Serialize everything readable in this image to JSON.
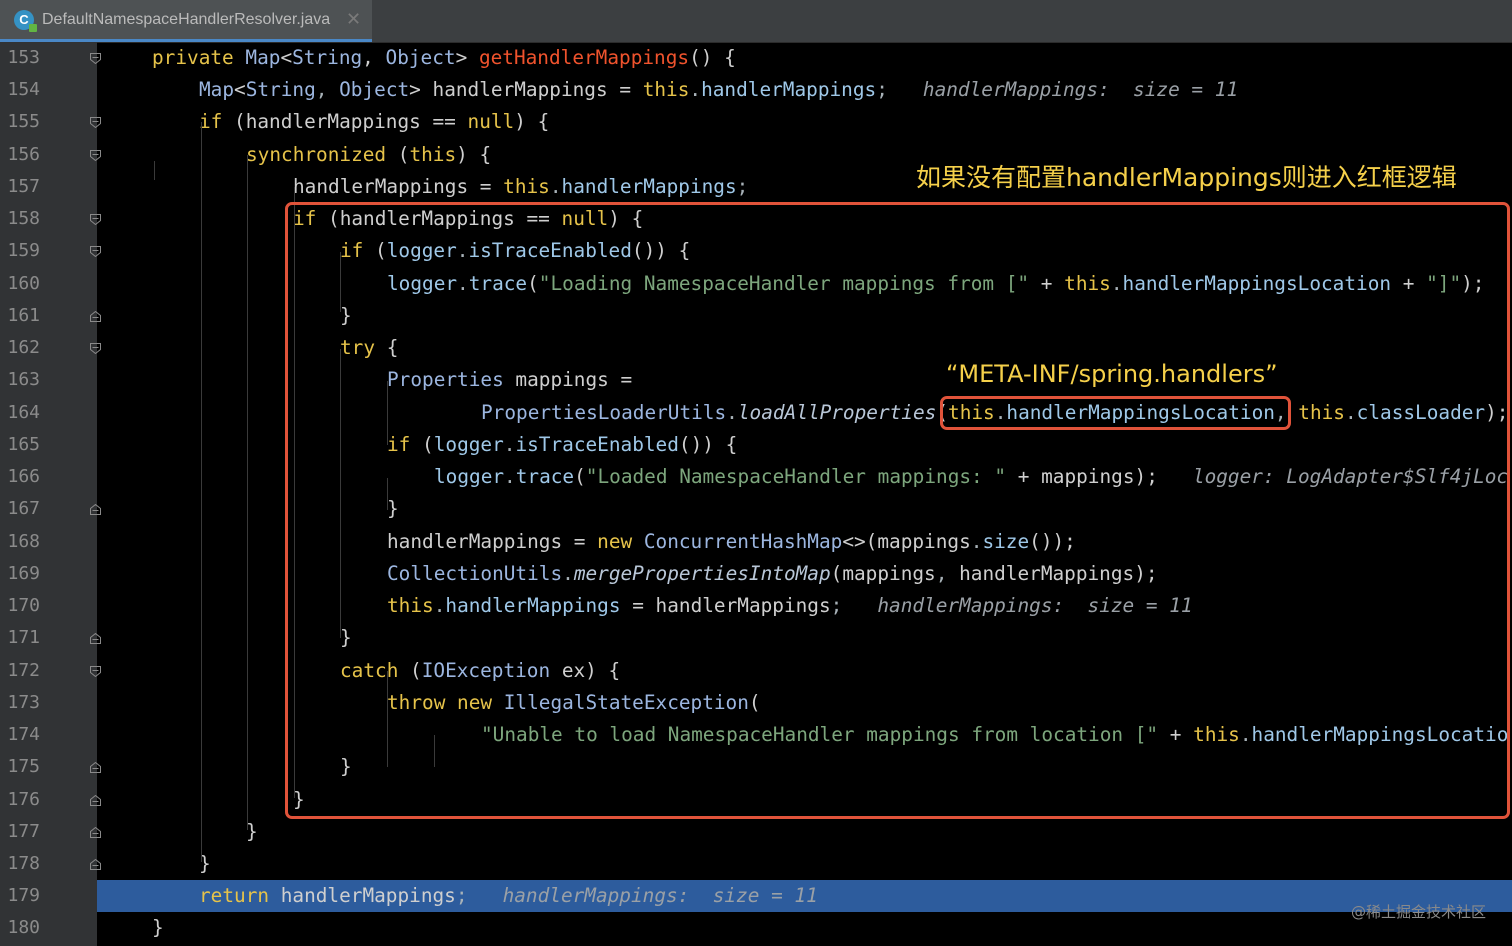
{
  "tab": {
    "title": "DefaultNamespaceHandlerResolver.java",
    "icon": "class-file-icon",
    "close": "✕"
  },
  "lines": [
    {
      "n": "153",
      "fold": "open",
      "indent": 0,
      "toks": [
        [
          "private ",
          "k"
        ],
        [
          "Map",
          "t"
        ],
        [
          "<",
          "p"
        ],
        [
          "String",
          "t"
        ],
        [
          ", ",
          "p"
        ],
        [
          "Object",
          "t"
        ],
        [
          "> ",
          "p"
        ],
        [
          "getHandlerMappings",
          "m"
        ],
        [
          "() {",
          "p"
        ]
      ]
    },
    {
      "n": "154",
      "fold": "",
      "indent": 1,
      "toks": [
        [
          "Map",
          "t"
        ],
        [
          "<",
          "p"
        ],
        [
          "String",
          "t"
        ],
        [
          ", ",
          "d"
        ],
        [
          "Object",
          "t"
        ],
        [
          "> ",
          "p"
        ],
        [
          "handlerMappings",
          "p"
        ],
        [
          " = ",
          "p"
        ],
        [
          "this",
          "k"
        ],
        [
          ".",
          "d"
        ],
        [
          "handlerMappings",
          "f"
        ],
        [
          ";",
          "d"
        ],
        [
          "   handlerMappings:  size = 11",
          "hint"
        ]
      ]
    },
    {
      "n": "155",
      "fold": "open",
      "indent": 1,
      "toks": [
        [
          "if ",
          "k"
        ],
        [
          "(handlerMappings ",
          "p"
        ],
        [
          "== ",
          "p"
        ],
        [
          "null",
          "k"
        ],
        [
          ") {",
          "p"
        ]
      ]
    },
    {
      "n": "156",
      "fold": "open",
      "indent": 2,
      "toks": [
        [
          "synchronized ",
          "k"
        ],
        [
          "(",
          "p"
        ],
        [
          "this",
          "k"
        ],
        [
          ") {",
          "p"
        ]
      ]
    },
    {
      "n": "157",
      "fold": "",
      "indent": 3,
      "toks": [
        [
          "handlerMappings",
          "p"
        ],
        [
          " = ",
          "p"
        ],
        [
          "this",
          "k"
        ],
        [
          ".",
          "d"
        ],
        [
          "handlerMappings",
          "f"
        ],
        [
          ";",
          "d"
        ]
      ]
    },
    {
      "n": "158",
      "fold": "open",
      "indent": 3,
      "toks": [
        [
          "if ",
          "k"
        ],
        [
          "(handlerMappings ",
          "p"
        ],
        [
          "== ",
          "p"
        ],
        [
          "null",
          "k"
        ],
        [
          ") {",
          "p"
        ]
      ]
    },
    {
      "n": "159",
      "fold": "open",
      "indent": 4,
      "toks": [
        [
          "if ",
          "k"
        ],
        [
          "(",
          "p"
        ],
        [
          "logger",
          "f"
        ],
        [
          ".",
          "d"
        ],
        [
          "isTraceEnabled",
          "f"
        ],
        [
          "()) {",
          "p"
        ]
      ]
    },
    {
      "n": "160",
      "fold": "",
      "indent": 5,
      "toks": [
        [
          "logger",
          "f"
        ],
        [
          ".",
          "d"
        ],
        [
          "trace",
          "f"
        ],
        [
          "(",
          "p"
        ],
        [
          "\"Loading NamespaceHandler mappings from [\"",
          "s"
        ],
        [
          " + ",
          "p"
        ],
        [
          "this",
          "k"
        ],
        [
          ".",
          "d"
        ],
        [
          "handlerMappingsLocation",
          "f"
        ],
        [
          " + ",
          "p"
        ],
        [
          "\"]\"",
          "s"
        ],
        [
          ");",
          "p"
        ]
      ]
    },
    {
      "n": "161",
      "fold": "close",
      "indent": 4,
      "toks": [
        [
          "}",
          "p"
        ]
      ]
    },
    {
      "n": "162",
      "fold": "open",
      "indent": 4,
      "toks": [
        [
          "try ",
          "k"
        ],
        [
          "{",
          "p"
        ]
      ]
    },
    {
      "n": "163",
      "fold": "",
      "indent": 5,
      "toks": [
        [
          "Properties ",
          "t"
        ],
        [
          "mappings",
          "p"
        ],
        [
          " =",
          "p"
        ]
      ]
    },
    {
      "n": "164",
      "fold": "",
      "indent": 7,
      "toks": [
        [
          "PropertiesLoaderUtils",
          "t"
        ],
        [
          ".",
          "d"
        ],
        [
          "loadAllProperties",
          "it"
        ],
        [
          "(",
          "p"
        ],
        [
          "this",
          "k"
        ],
        [
          ".",
          "d"
        ],
        [
          "handlerMappingsLocation",
          "f"
        ],
        [
          ", ",
          "d"
        ],
        [
          "this",
          "k"
        ],
        [
          ".",
          "d"
        ],
        [
          "classLoader",
          "f"
        ],
        [
          ");",
          "p"
        ]
      ]
    },
    {
      "n": "165",
      "fold": "",
      "indent": 5,
      "toks": [
        [
          "if ",
          "k"
        ],
        [
          "(",
          "p"
        ],
        [
          "logger",
          "f"
        ],
        [
          ".",
          "d"
        ],
        [
          "isTraceEnabled",
          "f"
        ],
        [
          "()) {",
          "p"
        ]
      ]
    },
    {
      "n": "166",
      "fold": "",
      "indent": 6,
      "toks": [
        [
          "logger",
          "f"
        ],
        [
          ".",
          "d"
        ],
        [
          "trace",
          "f"
        ],
        [
          "(",
          "p"
        ],
        [
          "\"Loaded NamespaceHandler mappings: \"",
          "s"
        ],
        [
          " + ",
          "p"
        ],
        [
          "mappings",
          "p"
        ],
        [
          ");",
          "p"
        ],
        [
          "   logger: LogAdapter$Slf4jLoc",
          "hint"
        ]
      ]
    },
    {
      "n": "167",
      "fold": "close",
      "indent": 5,
      "toks": [
        [
          "}",
          "p"
        ]
      ]
    },
    {
      "n": "168",
      "fold": "",
      "indent": 5,
      "toks": [
        [
          "handlerMappings",
          "p"
        ],
        [
          " = ",
          "p"
        ],
        [
          "new ",
          "k"
        ],
        [
          "ConcurrentHashMap",
          "t"
        ],
        [
          "<>(",
          "p"
        ],
        [
          "mappings",
          "p"
        ],
        [
          ".",
          "d"
        ],
        [
          "size",
          "f"
        ],
        [
          "());",
          "p"
        ]
      ]
    },
    {
      "n": "169",
      "fold": "",
      "indent": 5,
      "toks": [
        [
          "CollectionUtils",
          "t"
        ],
        [
          ".",
          "d"
        ],
        [
          "mergePropertiesIntoMap",
          "it"
        ],
        [
          "(mappings",
          "p"
        ],
        [
          ", ",
          "d"
        ],
        [
          "handlerMappings",
          "p"
        ],
        [
          ");",
          "p"
        ]
      ]
    },
    {
      "n": "170",
      "fold": "",
      "indent": 5,
      "toks": [
        [
          "this",
          "k"
        ],
        [
          ".",
          "d"
        ],
        [
          "handlerMappings",
          "f"
        ],
        [
          " = ",
          "p"
        ],
        [
          "handlerMappings",
          "p"
        ],
        [
          ";",
          "d"
        ],
        [
          "   handlerMappings:  size = 11",
          "hint"
        ]
      ]
    },
    {
      "n": "171",
      "fold": "close",
      "indent": 4,
      "toks": [
        [
          "}",
          "p"
        ]
      ]
    },
    {
      "n": "172",
      "fold": "open",
      "indent": 4,
      "toks": [
        [
          "catch ",
          "k"
        ],
        [
          "(",
          "p"
        ],
        [
          "IOException ",
          "t"
        ],
        [
          "ex) {",
          "p"
        ]
      ]
    },
    {
      "n": "173",
      "fold": "",
      "indent": 5,
      "toks": [
        [
          "throw ",
          "k"
        ],
        [
          "new ",
          "k"
        ],
        [
          "IllegalStateException",
          "t"
        ],
        [
          "(",
          "p"
        ]
      ]
    },
    {
      "n": "174",
      "fold": "",
      "indent": 7,
      "toks": [
        [
          "\"Unable to load NamespaceHandler mappings from location [\"",
          "s"
        ],
        [
          " + ",
          "p"
        ],
        [
          "this",
          "k"
        ],
        [
          ".",
          "d"
        ],
        [
          "handlerMappingsLocatio",
          "f"
        ]
      ]
    },
    {
      "n": "175",
      "fold": "close",
      "indent": 4,
      "toks": [
        [
          "}",
          "p"
        ]
      ]
    },
    {
      "n": "176",
      "fold": "close",
      "indent": 3,
      "toks": [
        [
          "}",
          "p"
        ]
      ]
    },
    {
      "n": "177",
      "fold": "close",
      "indent": 2,
      "toks": [
        [
          "}",
          "p"
        ]
      ]
    },
    {
      "n": "178",
      "fold": "close",
      "indent": 1,
      "toks": [
        [
          "}",
          "p"
        ]
      ]
    },
    {
      "n": "179",
      "fold": "",
      "indent": 1,
      "current": true,
      "toks": [
        [
          "return ",
          "k"
        ],
        [
          "handlerMappings",
          "p"
        ],
        [
          ";",
          "d"
        ],
        [
          "   handlerMappings:  size = 11",
          "hint"
        ]
      ]
    },
    {
      "n": "180",
      "fold": "",
      "indent": 0,
      "toks": [
        [
          "}",
          "p"
        ]
      ]
    }
  ],
  "annotations": {
    "box_note": "如果没有配置handlerMappings则进入红框逻辑",
    "location_note": "“META-INF/spring.handlers”"
  },
  "colors": {
    "box": "#e0533a",
    "annotation": "#f5d04a",
    "current_line": "#2d5c9d"
  },
  "watermark": "@稀土掘金技术社区"
}
